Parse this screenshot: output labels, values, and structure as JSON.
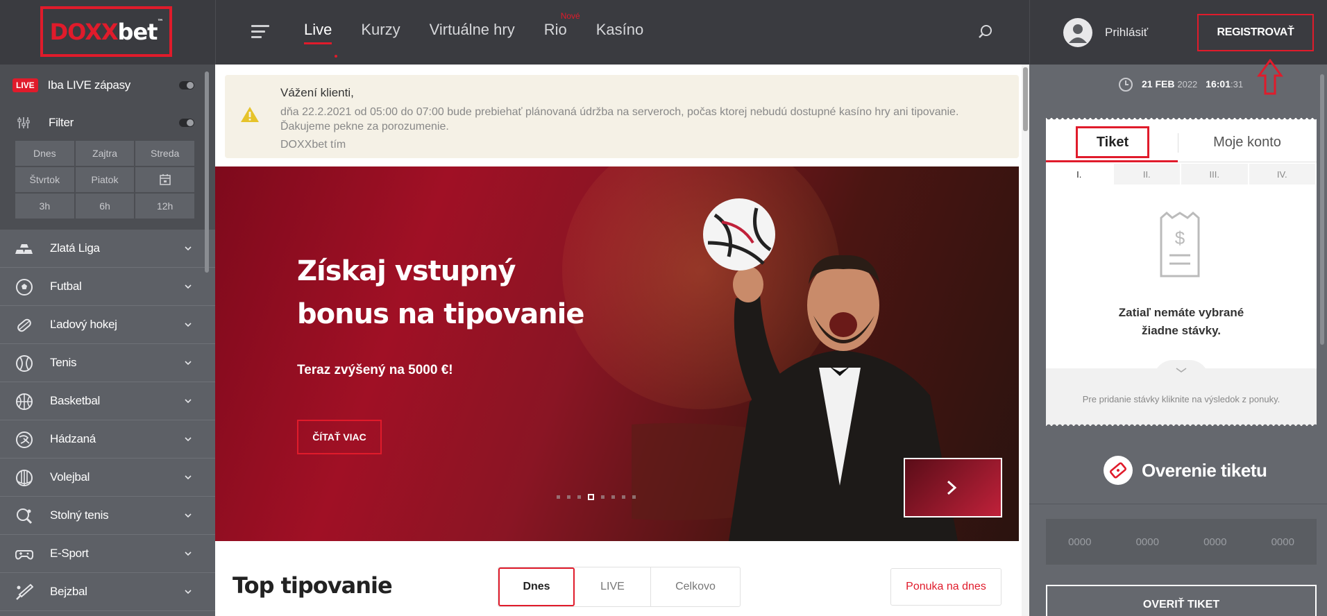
{
  "header": {
    "logo": "DOXXbet",
    "logo_tm": "™",
    "nav": [
      {
        "label": "Live",
        "active": true
      },
      {
        "label": "Kurzy"
      },
      {
        "label": "Virtuálne hry"
      },
      {
        "label": "Rio",
        "badge": "Nové"
      },
      {
        "label": "Kasíno"
      }
    ],
    "login_label": "Prihlásiť",
    "register_label": "REGISTROVAŤ"
  },
  "sidebar": {
    "live_badge": "LIVE",
    "live_only_label": "Iba LIVE zápasy",
    "filter_label": "Filter",
    "filters": [
      "Dnes",
      "Zajtra",
      "Streda",
      "Štvrtok",
      "Piatok",
      "calendar-icon",
      "3h",
      "6h",
      "12h"
    ],
    "sports": [
      {
        "label": "Zlatá Liga",
        "icon": "gold-bars-icon"
      },
      {
        "label": "Futbal",
        "icon": "soccer-ball-icon"
      },
      {
        "label": "Ľadový hokej",
        "icon": "hockey-puck-icon"
      },
      {
        "label": "Tenis",
        "icon": "tennis-ball-icon"
      },
      {
        "label": "Basketbal",
        "icon": "basketball-icon"
      },
      {
        "label": "Hádzaná",
        "icon": "handball-icon"
      },
      {
        "label": "Volejbal",
        "icon": "volleyball-icon"
      },
      {
        "label": "Stolný tenis",
        "icon": "table-tennis-icon"
      },
      {
        "label": "E-Sport",
        "icon": "gamepad-icon"
      },
      {
        "label": "Bejzbal",
        "icon": "baseball-bat-icon"
      }
    ]
  },
  "notice": {
    "title": "Vážení klienti,",
    "line1": "dňa 22.2.2021 od 05:00 do 07:00 bude prebiehať plánovaná údržba na serveroch, počas ktorej nebudú dostupné kasíno hry ani tipovanie.",
    "line2": "Ďakujeme pekne za porozumenie.",
    "signature": "DOXXbet tím"
  },
  "banner": {
    "title": "Získaj vstupný bonus na tipovanie",
    "subtitle": "Teraz zvýšený na 5000 €!",
    "cta": "ČÍTAŤ VIAC",
    "active_slide": 4,
    "slide_count": 8
  },
  "top": {
    "title": "Top tipovanie",
    "tabs": [
      "Dnes",
      "LIVE",
      "Celkovo"
    ],
    "active_tab": "Dnes",
    "offer_label": "Ponuka na dnes"
  },
  "right": {
    "date_day": "21 FEB",
    "date_year": "2022",
    "time_hm": "16:01",
    "time_s": ":31",
    "ticket_tab": "Tiket",
    "account_tab": "Moje konto",
    "ticket_slots": [
      "I.",
      "II.",
      "III.",
      "IV."
    ],
    "empty_line1": "Zatiaľ nemáte vybrané",
    "empty_line2": "žiadne stávky.",
    "hint": "Pre pridanie stávky kliknite na výsledok z ponuky.",
    "verify_title": "Overenie tiketu",
    "code_placeholders": [
      "0000",
      "0000",
      "0000",
      "0000"
    ],
    "verify_button": "OVERIŤ TIKET"
  },
  "colors": {
    "accent": "#e01b2b",
    "header": "#3a3b40",
    "sidebar": "#5d6066"
  }
}
